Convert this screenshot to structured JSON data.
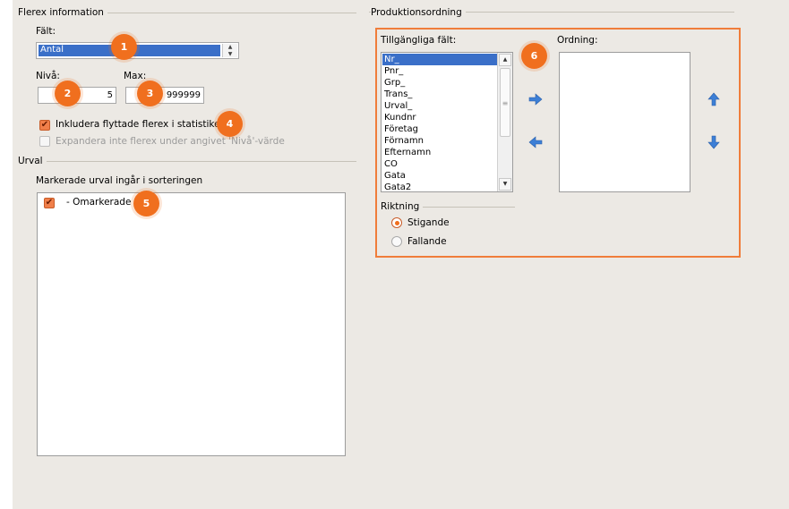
{
  "flerex": {
    "group_title": "Flerex information",
    "falt_label": "Fält:",
    "falt_value": "Antal",
    "niva_label": "Nivå:",
    "niva_value": "5",
    "max_label": "Max:",
    "max_value": "999999",
    "include_moved_label": "Inkludera flyttade flerex i statistiken",
    "include_moved_checked": true,
    "expand_label": "Expandera inte flerex under angivet 'Nivå'-värde",
    "expand_checked": false
  },
  "urval": {
    "group_title": "Urval",
    "list_label": "Markerade urval ingår i sorteringen",
    "items": [
      {
        "label": "- Omarkerade",
        "checked": true
      }
    ]
  },
  "produktion": {
    "group_title": "Produktionsordning",
    "available_label": "Tillgängliga fält:",
    "available_fields": [
      "Nr_",
      "Pnr_",
      "Grp_",
      "Trans_",
      "Urval_",
      "Kundnr",
      "Företag",
      "Förnamn",
      "Efternamn",
      "CO",
      "Gata",
      "Gata2"
    ],
    "selected_index": 0,
    "order_label": "Ordning:",
    "riktning_title": "Riktning",
    "stigande_label": "Stigande",
    "fallande_label": "Fallande",
    "selected_direction": "Stigande"
  },
  "badges": [
    "1",
    "2",
    "3",
    "4",
    "5",
    "6"
  ],
  "colors": {
    "badge": "#f06f1e",
    "highlight_border": "#f07d3a",
    "selection": "#3a6fc8",
    "arrow_blue": "#3d7fd6",
    "panel_bg": "#ece9e4"
  },
  "icons": {
    "move_right": "arrow-right-icon",
    "move_left": "arrow-left-icon",
    "move_up": "arrow-up-icon",
    "move_down": "arrow-down-icon"
  }
}
